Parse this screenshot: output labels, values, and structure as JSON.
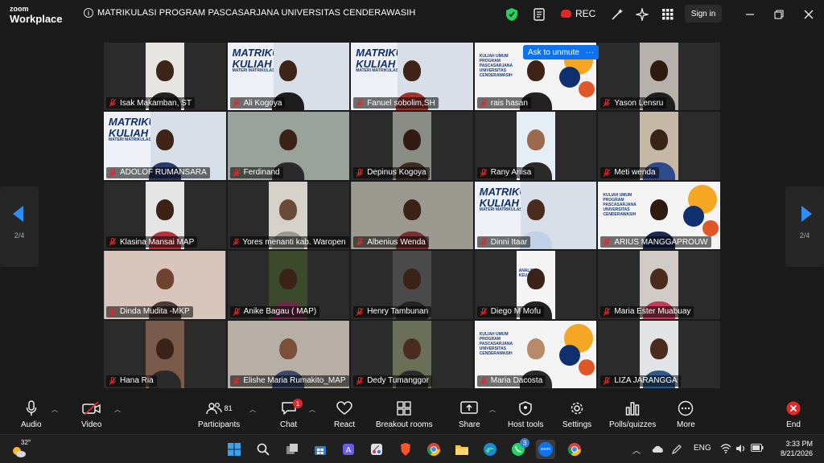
{
  "app": {
    "brand_line1": "zoom",
    "brand_line2": "Workplace",
    "meeting_title": "MATRIKULASI PROGRAM PASCASARJANA UNIVERSITAS CENDERAWASIH",
    "rec_label": "REC",
    "signin_label": "Sign in"
  },
  "colors": {
    "background": "#1a1a1a",
    "accent": "#0e72ed",
    "muted_red": "#e02828",
    "shield_green": "#23d160"
  },
  "participants": [
    {
      "name": "Isak Makamban, ST",
      "type": "person",
      "bg": "#e8e6e2",
      "skin": "#3b2418",
      "shirt": "#222"
    },
    {
      "name": "Ali Kogoya",
      "type": "slide",
      "bg": "#3a3a3a",
      "skin": "#3d2417",
      "shirt": "#1c1c1c"
    },
    {
      "name": "Fanuel sobolim,SH",
      "type": "slide",
      "bg": "#3a3a3a",
      "skin": "#3d2417",
      "shirt": "#a3332a"
    },
    {
      "name": "rais hasan",
      "type": "slide2",
      "bg": "#f2f2f2",
      "skin": "#3d2417",
      "shirt": "#222"
    },
    {
      "name": "Yason Lensru",
      "type": "person",
      "bg": "#b7b2ab",
      "skin": "#2f1a10",
      "shirt": "#1e1e1e"
    },
    {
      "name": "ADOLOF RUMANSARA",
      "type": "slide",
      "bg": "#3a3a3a",
      "skin": "#3d2417",
      "shirt": "#2b3b6b"
    },
    {
      "name": "Ferdinand",
      "type": "person-wide",
      "bg": "#9aa39b",
      "skin": "#3a2216",
      "shirt": "#2a2a2a"
    },
    {
      "name": "Depinus Kogoya",
      "type": "person",
      "bg": "#8a8c86",
      "skin": "#321c12",
      "shirt": "#3a2c22"
    },
    {
      "name": "Rany Anisa",
      "type": "person",
      "bg": "#e6eef5",
      "skin": "#9b6a4e",
      "shirt": "#2a2a2a"
    },
    {
      "name": "Meti wenda",
      "type": "person",
      "bg": "#c5b9a6",
      "skin": "#3a2216",
      "shirt": "#2f4a8a"
    },
    {
      "name": "Klasina Mansai MAP",
      "type": "person",
      "bg": "#e5e5e5",
      "skin": "#3a2216",
      "shirt": "#b8323a"
    },
    {
      "name": "Yores menanti kab. Waropen",
      "type": "person",
      "bg": "#d6d2ca",
      "skin": "#6a4a38",
      "shirt": "#9a9a92"
    },
    {
      "name": "Albenius Wenda",
      "type": "person-wide",
      "bg": "#9c9a90",
      "skin": "#3a2216",
      "shirt": "#7a3030"
    },
    {
      "name": "Dinni Itaar",
      "type": "slide",
      "bg": "#3a3a3a",
      "skin": "#4a2c1e",
      "shirt": "#c0d2e8"
    },
    {
      "name": "ARIUS MANGGAPROUW",
      "type": "slide2",
      "bg": "#f2f2f2",
      "skin": "#2f1a10",
      "shirt": "#1e2a50"
    },
    {
      "name": "Dinda Mudita -MKP",
      "type": "person-wide",
      "bg": "#d8c6bd",
      "skin": "#6e4430",
      "shirt": "#4a3a38"
    },
    {
      "name": "Anike Bagau ( MAP)",
      "type": "person",
      "bg": "#3a4a2a",
      "skin": "#3a2216",
      "shirt": "#6a2a4a"
    },
    {
      "name": "Henry Tambunan",
      "type": "person",
      "bg": "#4a4a4a",
      "skin": "#3a2216",
      "shirt": "#222"
    },
    {
      "name": "Diego M Mofu",
      "type": "slide3",
      "bg": "#f0f0f0",
      "skin": "#3a2216",
      "shirt": "#222"
    },
    {
      "name": "Maria Ester Muabuay",
      "type": "person",
      "bg": "#d0cbc5",
      "skin": "#4a2c1e",
      "shirt": "#c43a5a"
    },
    {
      "name": "Hana Ria",
      "type": "person",
      "bg": "#7a5a4a",
      "skin": "#3a2216",
      "shirt": "#2a2a2a"
    },
    {
      "name": "Elishe Maria Rumakito_MAP",
      "type": "person-wide",
      "bg": "#b7aea6",
      "skin": "#7a5038",
      "shirt": "#3a4a6a"
    },
    {
      "name": "Dedy Tumanggor",
      "type": "person",
      "bg": "#6a7058",
      "skin": "#4a2c1e",
      "shirt": "#2a2a2a"
    },
    {
      "name": "Maria Dacosta",
      "type": "slide2",
      "bg": "#f2f2f2",
      "skin": "#b88a6a",
      "shirt": "#2a2a2a"
    },
    {
      "name": "LIZA  JARANGGA",
      "type": "person",
      "bg": "#e2e4e6",
      "skin": "#4a2c1e",
      "shirt": "#2a5a8a"
    }
  ],
  "slide_text": {
    "title1": "MATRIKULASI",
    "title2": "KULIAH",
    "subtitle": "MATERI MATRIKULASI",
    "slide2_title": "KULIAH UMUM PROGRAM PASCASARJANA UNIVERSITAS CENDERAWASIH",
    "slide3_title": "ANALISIS KEUANGAN"
  },
  "ask_unmute": {
    "label": "Ask to unmute",
    "more": "···"
  },
  "pager": {
    "left": "2/4",
    "right": "2/4"
  },
  "toolbar": {
    "audio": "Audio",
    "video": "Video",
    "participants": "Participants",
    "participants_count": "81",
    "chat": "Chat",
    "chat_badge": "1",
    "react": "React",
    "breakout": "Breakout rooms",
    "share": "Share",
    "host_tools": "Host tools",
    "settings": "Settings",
    "polls": "Polls/quizzes",
    "more": "More",
    "end": "End"
  },
  "taskbar": {
    "temperature": "32°",
    "whatsapp_badge": "3",
    "zoom_label": "zoom",
    "language": "ENG",
    "time": "3:33 PM",
    "date": "8/21/2026"
  }
}
